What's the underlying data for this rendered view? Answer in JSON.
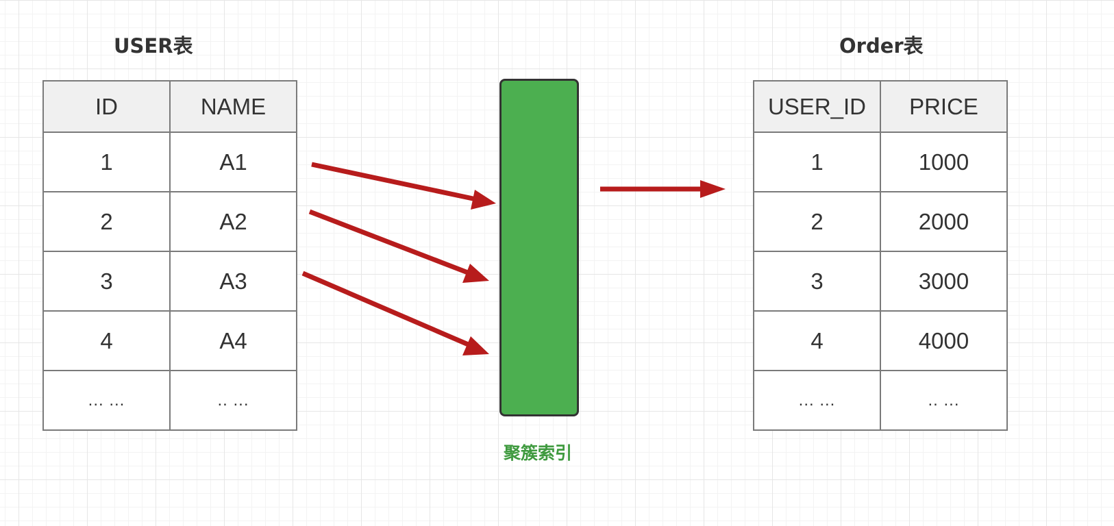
{
  "user_table": {
    "title": "USER表",
    "headers": [
      "ID",
      "NAME"
    ],
    "rows": [
      [
        "1",
        "A1"
      ],
      [
        "2",
        "A2"
      ],
      [
        "3",
        "A3"
      ],
      [
        "4",
        "A4"
      ],
      [
        "... ...",
        ".. ..."
      ]
    ]
  },
  "order_table": {
    "title": "Order表",
    "headers": [
      "USER_ID",
      "PRICE"
    ],
    "rows": [
      [
        "1",
        "1000"
      ],
      [
        "2",
        "2000"
      ],
      [
        "3",
        "3000"
      ],
      [
        "4",
        "4000"
      ],
      [
        "... ...",
        ".. ..."
      ]
    ]
  },
  "index": {
    "label": "聚簇索引",
    "fill_color": "#4caf50",
    "label_color": "#3f9a3f"
  },
  "arrow_color": "#b71c1c"
}
